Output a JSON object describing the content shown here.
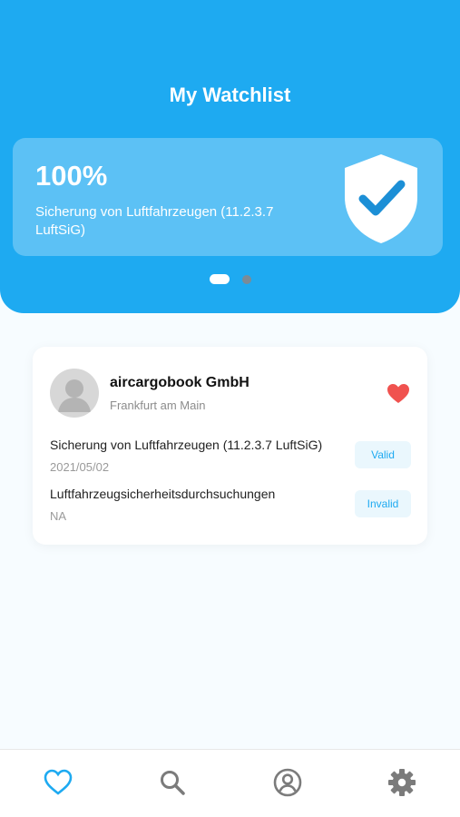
{
  "header": {
    "title": "My Watchlist",
    "background_color": "#1eaaf1"
  },
  "hero": {
    "percent": "100%",
    "description": "Sicherung von Luftfahrzeugen (11.2.3.7 LuftSiG)",
    "icon": "shield-check-icon",
    "carousel": {
      "pages": 2,
      "active": 1
    }
  },
  "company": {
    "name": "aircargobook GmbH",
    "city": "Frankfurt am Main",
    "favorite": true,
    "avatar_icon": "user-avatar-icon",
    "certifications": [
      {
        "title": "Sicherung von Luftfahrzeugen (11.2.3.7 LuftSiG)",
        "date": "2021/05/02",
        "status": "Valid"
      },
      {
        "title": "Luftfahrzeugsicherheitsdurchsuchungen",
        "date": "NA",
        "status": "Invalid"
      }
    ]
  },
  "bottom_nav": {
    "items": [
      {
        "icon": "heart-icon",
        "active": true
      },
      {
        "icon": "search-icon",
        "active": false
      },
      {
        "icon": "profile-icon",
        "active": false
      },
      {
        "icon": "gear-icon",
        "active": false
      }
    ]
  },
  "colors": {
    "accent": "#1eaaf1",
    "favorite": "#f0524f",
    "inactive_icon": "#7b7b7b"
  }
}
